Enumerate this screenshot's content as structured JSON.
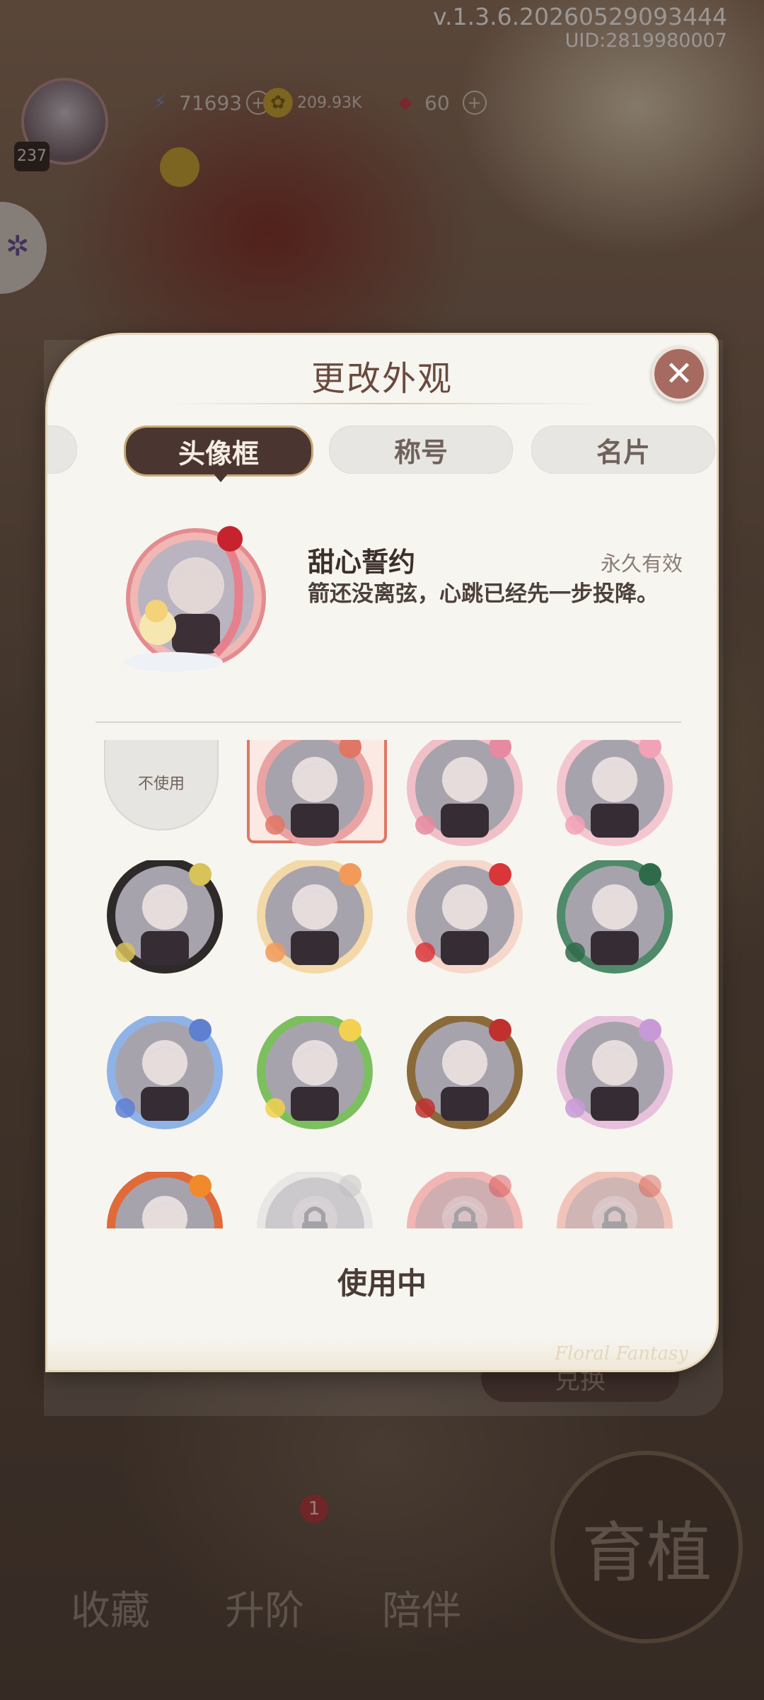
{
  "hud": {
    "version": "v.1.3.6.20260529093444",
    "uid": "UID:2819980007",
    "level": "237",
    "energy": "71693",
    "gold": "209.93K",
    "gems": "60"
  },
  "modal": {
    "title": "更改外观",
    "tabs": [
      {
        "label": ""
      },
      {
        "label": "头像框",
        "active": true
      },
      {
        "label": "称号"
      },
      {
        "label": "名片"
      }
    ],
    "selected_item": {
      "name": "甜心誓约",
      "validity": "永久有效",
      "description": "箭还没离弦，心跳已经先一步投降。"
    },
    "grid": {
      "unuse_label": "不使用",
      "frames": [
        {
          "icon": "cupid-ribbon-frame-icon",
          "selected": true,
          "locked": false
        },
        {
          "icon": "envelope-rose-frame-icon",
          "locked": false
        },
        {
          "icon": "pink-flower-frame-icon",
          "locked": false
        },
        {
          "icon": "music-note-frame-icon",
          "locked": false
        },
        {
          "icon": "cookie-cherry-frame-icon",
          "locked": false
        },
        {
          "icon": "lion-dance-frame-icon",
          "locked": false
        },
        {
          "icon": "pine-tree-frame-icon",
          "locked": false
        },
        {
          "icon": "moon-star-frame-icon",
          "locked": false
        },
        {
          "icon": "green-ribbon-frame-icon",
          "locked": false
        },
        {
          "icon": "gold-crown-frame-icon",
          "locked": false
        },
        {
          "icon": "lace-veil-frame-icon",
          "locked": false
        },
        {
          "icon": "orange-rose-frame-icon",
          "locked": false
        },
        {
          "icon": "silver-locked-frame-icon",
          "locked": true
        },
        {
          "icon": "firework-locked-frame-icon",
          "locked": true
        },
        {
          "icon": "lantern-locked-frame-icon",
          "locked": true
        }
      ]
    },
    "status": "使用中",
    "signature": "Floral Fantasy"
  },
  "background": {
    "nav": [
      "收藏",
      "升阶",
      "陪伴"
    ],
    "grow_button": "育植",
    "badge_count": "1",
    "hidden_button": "兑换"
  },
  "colors": {
    "accent_dark": "#4a3530",
    "close_button": "#a66a60",
    "selected_border": "#e07765"
  }
}
